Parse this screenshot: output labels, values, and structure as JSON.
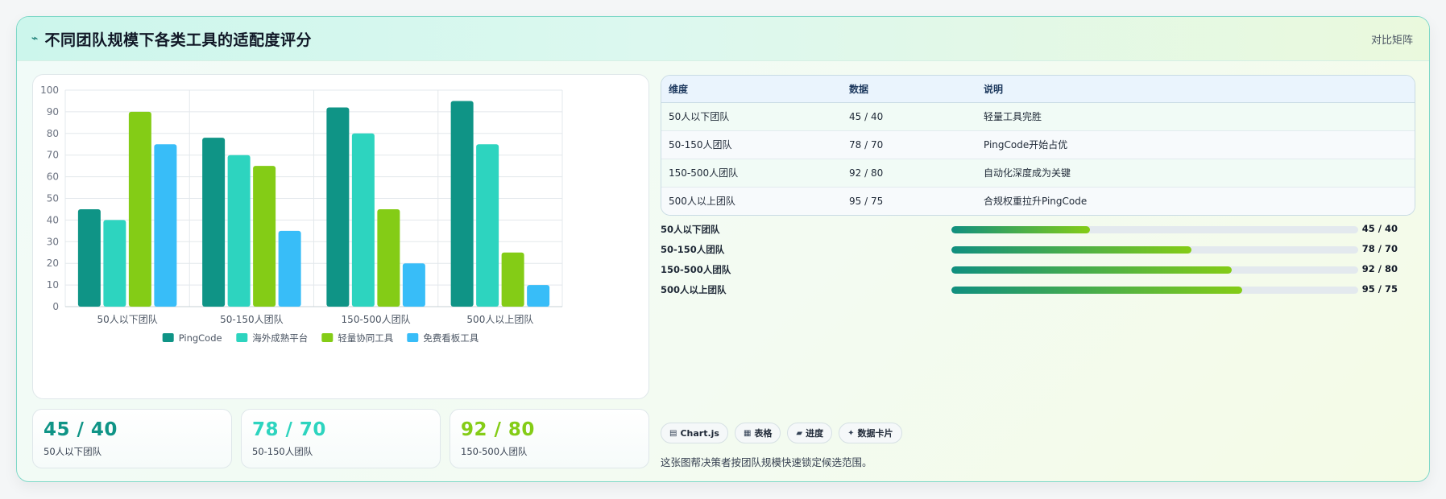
{
  "header": {
    "title": "不同团队规模下各类工具的适配度评分",
    "tag": "对比矩阵"
  },
  "colors": {
    "pingcode": "#0f9486",
    "overseas": "#2dd4bf",
    "light": "#84cc16",
    "free": "#38bdf8"
  },
  "chart_data": {
    "type": "bar",
    "categories": [
      "50人以下团队",
      "50-150人团队",
      "150-500人团队",
      "500人以上团队"
    ],
    "series": [
      {
        "name": "PingCode",
        "values": [
          45,
          78,
          92,
          95
        ],
        "color": "#0f9486"
      },
      {
        "name": "海外成熟平台",
        "values": [
          40,
          70,
          80,
          75
        ],
        "color": "#2dd4bf"
      },
      {
        "name": "轻量协同工具",
        "values": [
          90,
          65,
          45,
          25
        ],
        "color": "#84cc16"
      },
      {
        "name": "免费看板工具",
        "values": [
          75,
          35,
          20,
          10
        ],
        "color": "#38bdf8"
      }
    ],
    "ylim": [
      0,
      100
    ],
    "yticks": [
      0,
      10,
      20,
      30,
      40,
      50,
      60,
      70,
      80,
      90,
      100
    ],
    "grid": true,
    "legend": "bottom"
  },
  "kpis": [
    {
      "value": "45 / 40",
      "label": "50人以下团队",
      "color": "#0f9486"
    },
    {
      "value": "78 / 70",
      "label": "50-150人团队",
      "color": "#2dd4bf"
    },
    {
      "value": "92 / 80",
      "label": "150-500人团队",
      "color": "#84cc16"
    }
  ],
  "table": {
    "headers": [
      "维度",
      "数据",
      "说明"
    ],
    "rows": [
      [
        "50人以下团队",
        "45 / 40",
        "轻量工具完胜"
      ],
      [
        "50-150人团队",
        "78 / 70",
        "PingCode开始占优"
      ],
      [
        "150-500人团队",
        "92 / 80",
        "自动化深度成为关键"
      ],
      [
        "500人以上团队",
        "95 / 75",
        "合规权重拉升PingCode"
      ]
    ]
  },
  "progress": [
    {
      "label": "50人以下团队",
      "value": "45 / 40",
      "fraction": 0.34
    },
    {
      "label": "50-150人团队",
      "value": "78 / 70",
      "fraction": 0.59
    },
    {
      "label": "150-500人团队",
      "value": "92 / 80",
      "fraction": 0.69
    },
    {
      "label": "500人以上团队",
      "value": "95 / 75",
      "fraction": 0.715
    }
  ],
  "chips": [
    {
      "icon": "chart-icon",
      "glyph": "▤",
      "label": "Chart.js"
    },
    {
      "icon": "table-icon",
      "glyph": "▦",
      "label": "表格"
    },
    {
      "icon": "progress-icon",
      "glyph": "▰",
      "label": "进度"
    },
    {
      "icon": "sparkle-icon",
      "glyph": "✦",
      "label": "数据卡片"
    }
  ],
  "footnote": "这张图帮决策者按团队规模快速锁定候选范围。"
}
